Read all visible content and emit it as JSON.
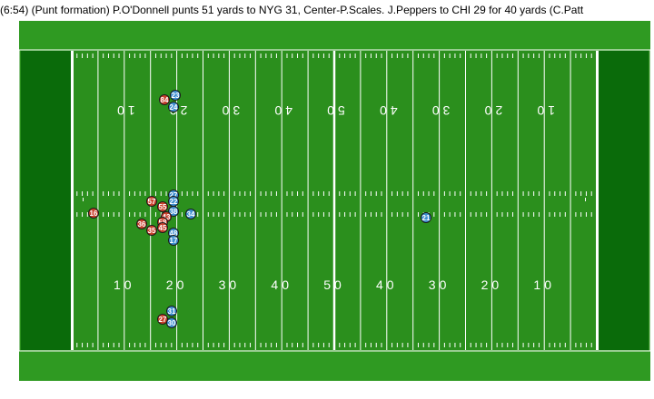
{
  "play_description": "(6:54) (Punt formation) P.O'Donnell punts 51 yards to NYG 31, Center-P.Scales. J.Peppers to CHI 29 for 40 yards (C.Patt",
  "colors": {
    "field": "#2b8f1d",
    "endzone": "#0a6b0a",
    "sideline": "#2f9a22",
    "lines": "#ffffff",
    "team_red": "#c9412c",
    "team_blue": "#3f8fd0"
  },
  "yard_labels_bottom": [
    "10",
    "20",
    "30",
    "40",
    "50",
    "40",
    "30",
    "20",
    "10"
  ],
  "yard_labels_top": [
    "10",
    "20",
    "30",
    "40",
    "50",
    "40",
    "30",
    "20",
    "10"
  ],
  "players": [
    {
      "number": "84",
      "team": "red"
    },
    {
      "number": "23",
      "team": "blue"
    },
    {
      "number": "24",
      "team": "blue"
    },
    {
      "number": "16",
      "team": "red"
    },
    {
      "number": "57",
      "team": "red"
    },
    {
      "number": "55",
      "team": "red"
    },
    {
      "number": "27",
      "team": "blue"
    },
    {
      "number": "22",
      "team": "blue"
    },
    {
      "number": "38",
      "team": "blue"
    },
    {
      "number": "34",
      "team": "blue"
    },
    {
      "number": "43",
      "team": "red"
    },
    {
      "number": "58",
      "team": "red"
    },
    {
      "number": "36",
      "team": "red"
    },
    {
      "number": "35",
      "team": "red"
    },
    {
      "number": "45",
      "team": "red"
    },
    {
      "number": "48",
      "team": "blue"
    },
    {
      "number": "17",
      "team": "blue"
    },
    {
      "number": "21",
      "team": "blue"
    },
    {
      "number": "31",
      "team": "blue"
    },
    {
      "number": "27",
      "team": "red"
    },
    {
      "number": "30",
      "team": "blue"
    }
  ]
}
